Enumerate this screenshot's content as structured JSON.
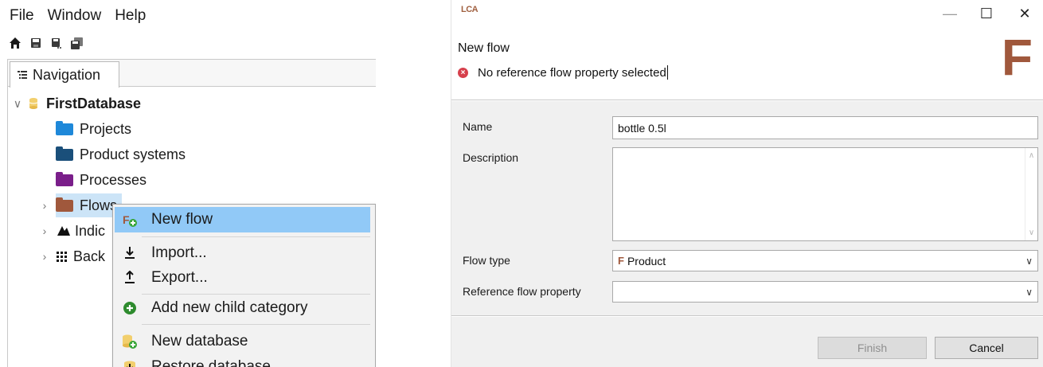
{
  "main_window": {
    "menu": [
      "File",
      "Window",
      "Help"
    ],
    "toolbar": [
      {
        "name": "home-icon",
        "icon": "home"
      },
      {
        "name": "save-icon",
        "icon": "save"
      },
      {
        "name": "save-as-icon",
        "icon": "save-as"
      },
      {
        "name": "save-all-icon",
        "icon": "save-all"
      }
    ],
    "tab_label": "Navigation",
    "tree": {
      "root": "FirstDatabase",
      "items": [
        {
          "label": "Projects",
          "color": "#1e88d9",
          "expandable": false
        },
        {
          "label": "Product systems",
          "color": "#1a4f7a",
          "expandable": false
        },
        {
          "label": "Processes",
          "color": "#7a1e8a",
          "expandable": false
        },
        {
          "label": "Flows",
          "color": "#a0583c",
          "expandable": true
        },
        {
          "label": "Indic",
          "color": "#111111",
          "expandable": true
        },
        {
          "label": "Back",
          "color": "#111111",
          "expandable": true
        }
      ]
    },
    "context_menu": {
      "new_flow": "New flow",
      "import": "Import...",
      "export": "Export...",
      "add_category": "Add new child category",
      "new_database": "New database",
      "restore_database": "Restore database"
    }
  },
  "dialog": {
    "logo": "LCA",
    "title": "New flow",
    "error": "No reference flow property selected",
    "header_letter": "F",
    "labels": {
      "name": "Name",
      "description": "Description",
      "flow_type": "Flow type",
      "ref_prop": "Reference flow property"
    },
    "values": {
      "name": "bottle 0.5l",
      "description": "",
      "flow_type": "Product",
      "ref_prop": ""
    },
    "buttons": {
      "finish": "Finish",
      "cancel": "Cancel"
    },
    "window_controls": {
      "minimize": "—",
      "maximize": "☐",
      "close": "✕"
    }
  },
  "colors": {
    "highlight": "#91c9f7",
    "selection": "#cce4f7",
    "brand": "#a0583c",
    "error": "#d6404c"
  }
}
